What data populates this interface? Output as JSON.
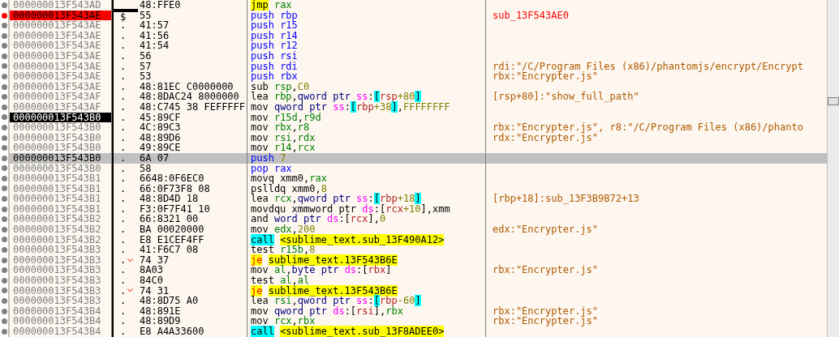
{
  "rows": [
    {
      "address": "000000013F543AD",
      "breakpoint": false,
      "current": false,
      "selected": false,
      "marker": "",
      "jump": false,
      "bytes": "48:FFE0",
      "mnemonic": {
        "text": "jmp",
        "kind": "jmp"
      },
      "operands": [
        {
          "text": "rax",
          "kind": "reg"
        }
      ]
    },
    {
      "address": "000000013F543AE",
      "breakpoint": true,
      "current": false,
      "selected": false,
      "marker": "$",
      "jump": false,
      "bytes": "55",
      "mnemonic": {
        "text": "push",
        "kind": "stack"
      },
      "operands": [
        {
          "text": "rbp",
          "kind": "stack"
        }
      ],
      "comment": {
        "text": "sub_13F543AE0",
        "kind": "label"
      }
    },
    {
      "address": "000000013F543AE",
      "breakpoint": false,
      "current": false,
      "selected": false,
      "marker": ".",
      "jump": false,
      "bytes": "41:57",
      "mnemonic": {
        "text": "push",
        "kind": "stack"
      },
      "operands": [
        {
          "text": "r15",
          "kind": "stack"
        }
      ]
    },
    {
      "address": "000000013F543AE",
      "breakpoint": false,
      "current": false,
      "selected": false,
      "marker": ".",
      "jump": false,
      "bytes": "41:56",
      "mnemonic": {
        "text": "push",
        "kind": "stack"
      },
      "operands": [
        {
          "text": "r14",
          "kind": "stack"
        }
      ]
    },
    {
      "address": "000000013F543AE",
      "breakpoint": false,
      "current": false,
      "selected": false,
      "marker": ".",
      "jump": false,
      "bytes": "41:54",
      "mnemonic": {
        "text": "push",
        "kind": "stack"
      },
      "operands": [
        {
          "text": "r12",
          "kind": "stack"
        }
      ]
    },
    {
      "address": "000000013F543AE",
      "breakpoint": false,
      "current": false,
      "selected": false,
      "marker": ".",
      "jump": false,
      "bytes": "56",
      "mnemonic": {
        "text": "push",
        "kind": "stack"
      },
      "operands": [
        {
          "text": "rsi",
          "kind": "stack"
        }
      ]
    },
    {
      "address": "000000013F543AE",
      "breakpoint": false,
      "current": false,
      "selected": false,
      "marker": ".",
      "jump": false,
      "bytes": "57",
      "mnemonic": {
        "text": "push",
        "kind": "stack"
      },
      "operands": [
        {
          "text": "rdi",
          "kind": "stack"
        }
      ],
      "comment": {
        "text": "rdi:\"/C/Program Files (x86)/phantomjs/encrypt/Encrypt",
        "kind": "value"
      }
    },
    {
      "address": "000000013F543AE",
      "breakpoint": false,
      "current": false,
      "selected": false,
      "marker": ".",
      "jump": false,
      "bytes": "53",
      "mnemonic": {
        "text": "push",
        "kind": "stack"
      },
      "operands": [
        {
          "text": "rbx",
          "kind": "stack"
        }
      ],
      "comment": {
        "text": "rbx:\"Encrypter.js\"",
        "kind": "value"
      }
    },
    {
      "address": "000000013F543AE",
      "breakpoint": false,
      "current": false,
      "selected": false,
      "marker": ".",
      "jump": false,
      "bytes": "48:81EC C0000000",
      "mnemonic": {
        "text": "sub",
        "kind": "plain"
      },
      "operands": [
        {
          "text": "rsp",
          "kind": "reg"
        },
        {
          "text": ",",
          "kind": "text"
        },
        {
          "text": "C0",
          "kind": "num"
        }
      ]
    },
    {
      "address": "000000013F543AF",
      "breakpoint": false,
      "current": false,
      "selected": false,
      "marker": ".",
      "jump": false,
      "bytes": "48:8DAC24 8000000",
      "mnemonic": {
        "text": "lea",
        "kind": "plain"
      },
      "operands": [
        {
          "text": "rbp",
          "kind": "reg"
        },
        {
          "text": ",",
          "kind": "text"
        },
        {
          "text": "qword ptr",
          "kind": "ptr"
        },
        {
          "text": "ss",
          "kind": "seg"
        },
        {
          "text": ":",
          "kind": "text"
        },
        {
          "text": "[",
          "kind": "bracket"
        },
        {
          "text": "rsp",
          "kind": "memreg"
        },
        {
          "text": "+80",
          "kind": "num"
        },
        {
          "text": "]",
          "kind": "bracket"
        }
      ],
      "comment": {
        "text": "[rsp+80]:\"show_full_path\"",
        "kind": "value"
      }
    },
    {
      "address": "000000013F543AF",
      "breakpoint": false,
      "current": false,
      "selected": false,
      "marker": ".",
      "jump": false,
      "bytes": "48:C745 38 FEFFFFF",
      "mnemonic": {
        "text": "mov",
        "kind": "plain"
      },
      "operands": [
        {
          "text": "qword ptr",
          "kind": "ptr"
        },
        {
          "text": "ss",
          "kind": "seg"
        },
        {
          "text": ":",
          "kind": "text"
        },
        {
          "text": "[",
          "kind": "bracket"
        },
        {
          "text": "rbp",
          "kind": "memreg"
        },
        {
          "text": "+38",
          "kind": "num"
        },
        {
          "text": "]",
          "kind": "bracket"
        },
        {
          "text": ",",
          "kind": "text"
        },
        {
          "text": "FFFFFFFF",
          "kind": "num"
        }
      ]
    },
    {
      "address": "000000013F543B0",
      "breakpoint": false,
      "current": true,
      "selected": false,
      "marker": ".",
      "jump": false,
      "bytes": "45:89CF",
      "mnemonic": {
        "text": "mov",
        "kind": "plain"
      },
      "operands": [
        {
          "text": "r15d",
          "kind": "reg"
        },
        {
          "text": ",",
          "kind": "text"
        },
        {
          "text": "r9d",
          "kind": "reg"
        }
      ]
    },
    {
      "address": "000000013F543B0",
      "breakpoint": false,
      "current": false,
      "selected": false,
      "marker": ".",
      "jump": false,
      "bytes": "4C:89C3",
      "mnemonic": {
        "text": "mov",
        "kind": "plain"
      },
      "operands": [
        {
          "text": "rbx",
          "kind": "reg"
        },
        {
          "text": ",",
          "kind": "text"
        },
        {
          "text": "r8",
          "kind": "reg"
        }
      ],
      "comment": {
        "text": "rbx:\"Encrypter.js\", r8:\"/C/Program Files (x86)/phanto",
        "kind": "value"
      }
    },
    {
      "address": "000000013F543B0",
      "breakpoint": false,
      "current": false,
      "selected": false,
      "marker": ".",
      "jump": false,
      "bytes": "48:89D6",
      "mnemonic": {
        "text": "mov",
        "kind": "plain"
      },
      "operands": [
        {
          "text": "rsi",
          "kind": "reg"
        },
        {
          "text": ",",
          "kind": "text"
        },
        {
          "text": "rdx",
          "kind": "reg"
        }
      ],
      "comment": {
        "text": "rdx:\"Encrypter.js\"",
        "kind": "value"
      }
    },
    {
      "address": "000000013F543B0",
      "breakpoint": false,
      "current": false,
      "selected": false,
      "marker": ".",
      "jump": false,
      "bytes": "49:89CE",
      "mnemonic": {
        "text": "mov",
        "kind": "plain"
      },
      "operands": [
        {
          "text": "r14",
          "kind": "reg"
        },
        {
          "text": ",",
          "kind": "text"
        },
        {
          "text": "rcx",
          "kind": "reg"
        }
      ]
    },
    {
      "address": "000000013F543B0",
      "breakpoint": false,
      "current": false,
      "selected": true,
      "marker": ".",
      "jump": false,
      "bytes": "6A 07",
      "mnemonic": {
        "text": "push",
        "kind": "stack"
      },
      "operands": [
        {
          "text": "7",
          "kind": "num"
        }
      ]
    },
    {
      "address": "000000013F543B0",
      "breakpoint": false,
      "current": false,
      "selected": false,
      "marker": ".",
      "jump": false,
      "bytes": "58",
      "mnemonic": {
        "text": "pop",
        "kind": "stack"
      },
      "operands": [
        {
          "text": "rax",
          "kind": "stack"
        }
      ]
    },
    {
      "address": "000000013F543B1",
      "breakpoint": false,
      "current": false,
      "selected": false,
      "marker": ".",
      "jump": false,
      "bytes": "6648:0F6EC0",
      "mnemonic": {
        "text": "movq",
        "kind": "plain"
      },
      "operands": [
        {
          "text": "xmm0",
          "kind": "text"
        },
        {
          "text": ",",
          "kind": "text"
        },
        {
          "text": "rax",
          "kind": "reg"
        }
      ]
    },
    {
      "address": "000000013F543B1",
      "breakpoint": false,
      "current": false,
      "selected": false,
      "marker": ".",
      "jump": false,
      "bytes": "66:0F73F8 08",
      "mnemonic": {
        "text": "pslldq",
        "kind": "plain"
      },
      "operands": [
        {
          "text": "xmm0",
          "kind": "text"
        },
        {
          "text": ",",
          "kind": "text"
        },
        {
          "text": "8",
          "kind": "num"
        }
      ]
    },
    {
      "address": "000000013F543B1",
      "breakpoint": false,
      "current": false,
      "selected": false,
      "marker": ".",
      "jump": false,
      "bytes": "48:8D4D 18",
      "mnemonic": {
        "text": "lea",
        "kind": "plain"
      },
      "operands": [
        {
          "text": "rcx",
          "kind": "reg"
        },
        {
          "text": ",",
          "kind": "text"
        },
        {
          "text": "qword ptr",
          "kind": "ptr"
        },
        {
          "text": "ss",
          "kind": "seg"
        },
        {
          "text": ":",
          "kind": "text"
        },
        {
          "text": "[",
          "kind": "bracket"
        },
        {
          "text": "rbp",
          "kind": "memreg"
        },
        {
          "text": "+18",
          "kind": "num"
        },
        {
          "text": "]",
          "kind": "bracket"
        }
      ],
      "comment": {
        "text": "[rbp+18]:sub_13F3B9B72+13",
        "kind": "value"
      }
    },
    {
      "address": "000000013F543B1",
      "breakpoint": false,
      "current": false,
      "selected": false,
      "marker": ".",
      "jump": false,
      "bytes": "F3:0F7F41 10",
      "mnemonic": {
        "text": "movdqu",
        "kind": "plain"
      },
      "operands": [
        {
          "text": "xmmword ptr",
          "kind": "ptrtext"
        },
        {
          "text": "ds",
          "kind": "seg"
        },
        {
          "text": ":[",
          "kind": "text"
        },
        {
          "text": "rcx",
          "kind": "memreg"
        },
        {
          "text": "+10",
          "kind": "num"
        },
        {
          "text": "],xmm",
          "kind": "text"
        }
      ]
    },
    {
      "address": "000000013F543B2",
      "breakpoint": false,
      "current": false,
      "selected": false,
      "marker": ".",
      "jump": false,
      "bytes": "66:8321 00",
      "mnemonic": {
        "text": "and",
        "kind": "plain"
      },
      "operands": [
        {
          "text": "word ptr",
          "kind": "ptr"
        },
        {
          "text": "ds",
          "kind": "seg"
        },
        {
          "text": ":[",
          "kind": "text"
        },
        {
          "text": "rcx",
          "kind": "memreg"
        },
        {
          "text": "],",
          "kind": "text"
        },
        {
          "text": "0",
          "kind": "num"
        }
      ]
    },
    {
      "address": "000000013F543B2",
      "breakpoint": false,
      "current": false,
      "selected": false,
      "marker": ".",
      "jump": false,
      "bytes": "BA 00020000",
      "mnemonic": {
        "text": "mov",
        "kind": "plain"
      },
      "operands": [
        {
          "text": "edx",
          "kind": "reg"
        },
        {
          "text": ",",
          "kind": "text"
        },
        {
          "text": "200",
          "kind": "num"
        }
      ],
      "comment": {
        "text": "edx:\"Encrypter.js\"",
        "kind": "value"
      }
    },
    {
      "address": "000000013F543B2",
      "breakpoint": false,
      "current": false,
      "selected": false,
      "marker": ".",
      "jump": false,
      "bytes": "E8 E1CEF4FF",
      "mnemonic": {
        "text": "call",
        "kind": "call"
      },
      "operands": [
        {
          "text": "<sublime_text.sub_13F490A12>",
          "kind": "target"
        }
      ]
    },
    {
      "address": "000000013F543B3",
      "breakpoint": false,
      "current": false,
      "selected": false,
      "marker": ".",
      "jump": false,
      "bytes": "41:F6C7 08",
      "mnemonic": {
        "text": "test",
        "kind": "plain"
      },
      "operands": [
        {
          "text": "r15b",
          "kind": "reg"
        },
        {
          "text": ",",
          "kind": "text"
        },
        {
          "text": "8",
          "kind": "num"
        }
      ]
    },
    {
      "address": "000000013F543B3",
      "breakpoint": false,
      "current": false,
      "selected": false,
      "marker": ".",
      "jump": true,
      "bytes": "74 37",
      "mnemonic": {
        "text": "je",
        "kind": "jcc"
      },
      "operands": [
        {
          "text": "sublime_text.13F543B6E",
          "kind": "target"
        }
      ]
    },
    {
      "address": "000000013F543B3",
      "breakpoint": false,
      "current": false,
      "selected": false,
      "marker": ".",
      "jump": false,
      "bytes": "8A03",
      "mnemonic": {
        "text": "mov",
        "kind": "plain"
      },
      "operands": [
        {
          "text": "al",
          "kind": "reg"
        },
        {
          "text": ",",
          "kind": "text"
        },
        {
          "text": "byte ptr",
          "kind": "ptr"
        },
        {
          "text": "ds",
          "kind": "seg"
        },
        {
          "text": ":[",
          "kind": "text"
        },
        {
          "text": "rbx",
          "kind": "memreg"
        },
        {
          "text": "]",
          "kind": "text"
        }
      ],
      "comment": {
        "text": "rbx:\"Encrypter.js\"",
        "kind": "value"
      }
    },
    {
      "address": "000000013F543B3",
      "breakpoint": false,
      "current": false,
      "selected": false,
      "marker": ".",
      "jump": false,
      "bytes": "84C0",
      "mnemonic": {
        "text": "test",
        "kind": "plain"
      },
      "operands": [
        {
          "text": "al",
          "kind": "reg"
        },
        {
          "text": ",",
          "kind": "text"
        },
        {
          "text": "al",
          "kind": "reg"
        }
      ]
    },
    {
      "address": "000000013F543B3",
      "breakpoint": false,
      "current": false,
      "selected": false,
      "marker": ".",
      "jump": true,
      "bytes": "74 31",
      "mnemonic": {
        "text": "je",
        "kind": "jcc"
      },
      "operands": [
        {
          "text": "sublime_text.13F543B6E",
          "kind": "target"
        }
      ]
    },
    {
      "address": "000000013F543B3",
      "breakpoint": false,
      "current": false,
      "selected": false,
      "marker": ".",
      "jump": false,
      "bytes": "48:8D75 A0",
      "mnemonic": {
        "text": "lea",
        "kind": "plain"
      },
      "operands": [
        {
          "text": "rsi",
          "kind": "reg"
        },
        {
          "text": ",",
          "kind": "text"
        },
        {
          "text": "qword ptr",
          "kind": "ptr"
        },
        {
          "text": "ss",
          "kind": "seg"
        },
        {
          "text": ":",
          "kind": "text"
        },
        {
          "text": "[",
          "kind": "bracket"
        },
        {
          "text": "rbp",
          "kind": "memreg"
        },
        {
          "text": "-60",
          "kind": "num"
        },
        {
          "text": "]",
          "kind": "bracket"
        }
      ]
    },
    {
      "address": "000000013F543B4",
      "breakpoint": false,
      "current": false,
      "selected": false,
      "marker": ".",
      "jump": false,
      "bytes": "48:891E",
      "mnemonic": {
        "text": "mov",
        "kind": "plain"
      },
      "operands": [
        {
          "text": "qword ptr",
          "kind": "ptr"
        },
        {
          "text": "ds",
          "kind": "seg"
        },
        {
          "text": ":[",
          "kind": "text"
        },
        {
          "text": "rsi",
          "kind": "memreg"
        },
        {
          "text": "],",
          "kind": "text"
        },
        {
          "text": "rbx",
          "kind": "reg"
        }
      ],
      "comment": {
        "text": "rbx:\"Encrypter.js\"",
        "kind": "value"
      }
    },
    {
      "address": "000000013F543B4",
      "breakpoint": false,
      "current": false,
      "selected": false,
      "marker": ".",
      "jump": false,
      "bytes": "48:89D9",
      "mnemonic": {
        "text": "mov",
        "kind": "plain"
      },
      "operands": [
        {
          "text": "rcx",
          "kind": "reg"
        },
        {
          "text": ",",
          "kind": "text"
        },
        {
          "text": "rbx",
          "kind": "reg"
        }
      ],
      "comment": {
        "text": "rbx:\"Encrypter.js\"",
        "kind": "value"
      }
    },
    {
      "address": "000000013F543B4",
      "breakpoint": false,
      "current": false,
      "selected": false,
      "marker": ".",
      "jump": false,
      "bytes": "E8 A4A33600",
      "mnemonic": {
        "text": "call",
        "kind": "call"
      },
      "operands": [
        {
          "text": "<sublime_text.sub_13F8ADEE0>",
          "kind": "target"
        }
      ]
    }
  ]
}
